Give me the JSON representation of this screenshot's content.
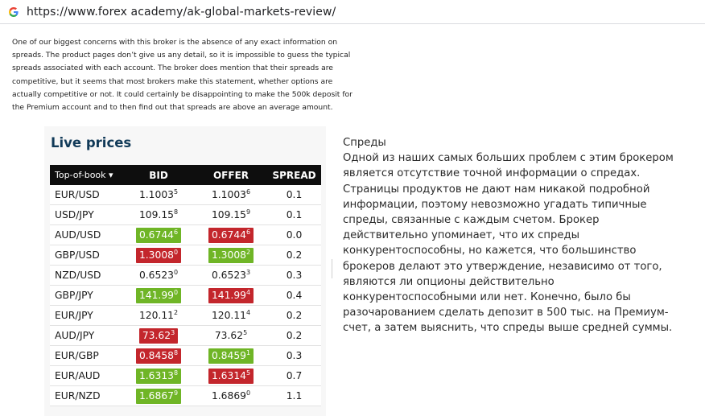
{
  "browser": {
    "url": "https://www.forex academy/ak-global-markets-review/",
    "icon": "google-g-icon"
  },
  "article": {
    "english_paragraph": "One of our biggest concerns with this broker is the absence of any exact information on spreads. The product pages don’t give us any detail, so it is impossible to guess the typical spreads associated with each account. The broker does mention that their spreads are competitive, but it seems that most brokers make this statement, whether options are actually competitive or not. It could certainly be disappointing to make the 500k deposit for the Premium account and to then find out that spreads are above an average amount.",
    "russian_text": "Спреды\nОдной из наших самых больших проблем с этим брокером является отсутствие точной информации о спредах. Страницы продуктов не дают нам никакой подробной информации, поэтому невозможно угадать типичные спреды, связанные с каждым счетом. Брокер действительно упоминает, что их спреды конкурентоспособны, но кажется, что большинство брокеров делают это утверждение, независимо от того, являются ли опционы действительно конкурентоспособными или нет. Конечно, было бы разочарованием сделать депозит в 500 тыс. на Премиум-счет, а затем выяснить, что спреды выше средней суммы."
  },
  "live_prices": {
    "title": "Live prices",
    "columns": {
      "pair": "Top-of-book ▾",
      "bid": "BID",
      "offer": "OFFER",
      "spread": "SPREAD"
    },
    "colors": {
      "up": "#6fb526",
      "down": "#c3262c",
      "header": "#0e0e0e",
      "title": "#113a58"
    },
    "rows": [
      {
        "pair": "EUR/USD",
        "bid": "1.1003",
        "bid_pip": "5",
        "bid_state": "none",
        "offer": "1.1003",
        "offer_pip": "6",
        "offer_state": "none",
        "spread": "0.1"
      },
      {
        "pair": "USD/JPY",
        "bid": "109.15",
        "bid_pip": "8",
        "bid_state": "none",
        "offer": "109.15",
        "offer_pip": "9",
        "offer_state": "none",
        "spread": "0.1"
      },
      {
        "pair": "AUD/USD",
        "bid": "0.6744",
        "bid_pip": "6",
        "bid_state": "up",
        "offer": "0.6744",
        "offer_pip": "6",
        "offer_state": "down",
        "spread": "0.0"
      },
      {
        "pair": "GBP/USD",
        "bid": "1.3008",
        "bid_pip": "0",
        "bid_state": "down",
        "offer": "1.3008",
        "offer_pip": "2",
        "offer_state": "up",
        "spread": "0.2"
      },
      {
        "pair": "NZD/USD",
        "bid": "0.6523",
        "bid_pip": "0",
        "bid_state": "none",
        "offer": "0.6523",
        "offer_pip": "3",
        "offer_state": "none",
        "spread": "0.3"
      },
      {
        "pair": "GBP/JPY",
        "bid": "141.99",
        "bid_pip": "0",
        "bid_state": "up",
        "offer": "141.99",
        "offer_pip": "4",
        "offer_state": "down",
        "spread": "0.4"
      },
      {
        "pair": "EUR/JPY",
        "bid": "120.11",
        "bid_pip": "2",
        "bid_state": "none",
        "offer": "120.11",
        "offer_pip": "4",
        "offer_state": "none",
        "spread": "0.2"
      },
      {
        "pair": "AUD/JPY",
        "bid": "73.62",
        "bid_pip": "3",
        "bid_state": "down",
        "offer": "73.62",
        "offer_pip": "5",
        "offer_state": "none",
        "spread": "0.2"
      },
      {
        "pair": "EUR/GBP",
        "bid": "0.8458",
        "bid_pip": "8",
        "bid_state": "down",
        "offer": "0.8459",
        "offer_pip": "1",
        "offer_state": "up",
        "spread": "0.3"
      },
      {
        "pair": "EUR/AUD",
        "bid": "1.6313",
        "bid_pip": "8",
        "bid_state": "up",
        "offer": "1.6314",
        "offer_pip": "5",
        "offer_state": "down",
        "spread": "0.7"
      },
      {
        "pair": "EUR/NZD",
        "bid": "1.6867",
        "bid_pip": "9",
        "bid_state": "up",
        "offer": "1.6869",
        "offer_pip": "0",
        "offer_state": "none",
        "spread": "1.1"
      }
    ]
  }
}
